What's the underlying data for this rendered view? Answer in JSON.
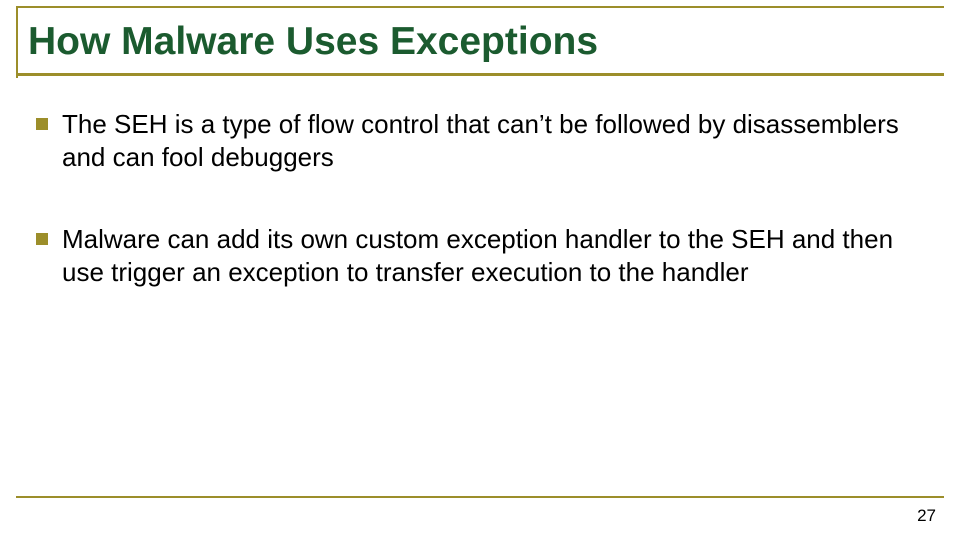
{
  "title": "How Malware Uses  Exceptions",
  "bullets": [
    "The SEH is a type of flow control that can’t be followed by disassemblers and can fool debuggers",
    "Malware can add its own custom exception handler to the SEH and then use trigger an exception to transfer execution to the handler"
  ],
  "page_number": "27",
  "colors": {
    "accent": "#9c8e2a",
    "title": "#1b5b2f"
  }
}
